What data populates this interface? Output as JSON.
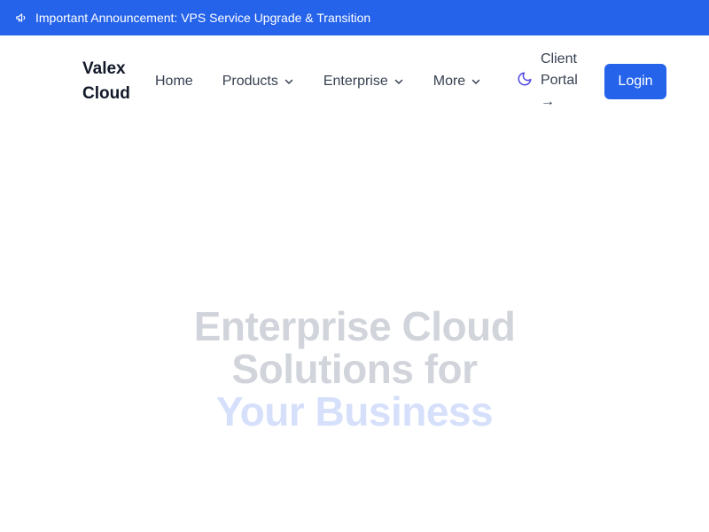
{
  "announcement": {
    "icon": "megaphone-icon",
    "text": "Important Announcement: VPS Service Upgrade & Transition",
    "bg_color": "#2563eb"
  },
  "header": {
    "brand_line1": "Valex",
    "brand_line2": "Cloud",
    "nav": [
      {
        "label": "Home",
        "has_dropdown": false
      },
      {
        "label": "Products",
        "has_dropdown": true
      },
      {
        "label": "Enterprise",
        "has_dropdown": true
      },
      {
        "label": "More",
        "has_dropdown": true
      }
    ],
    "theme_icon": "moon-icon",
    "client_portal_line1": "Client",
    "client_portal_line2": "Portal",
    "client_portal_arrow": "→",
    "login_label": "Login",
    "accent_color": "#2563eb"
  },
  "hero": {
    "line1": "Enterprise Cloud",
    "line2": "Solutions for",
    "line3": "Your Business",
    "line_color": "#d1d5db",
    "highlight_color": "#d6e0fb"
  }
}
